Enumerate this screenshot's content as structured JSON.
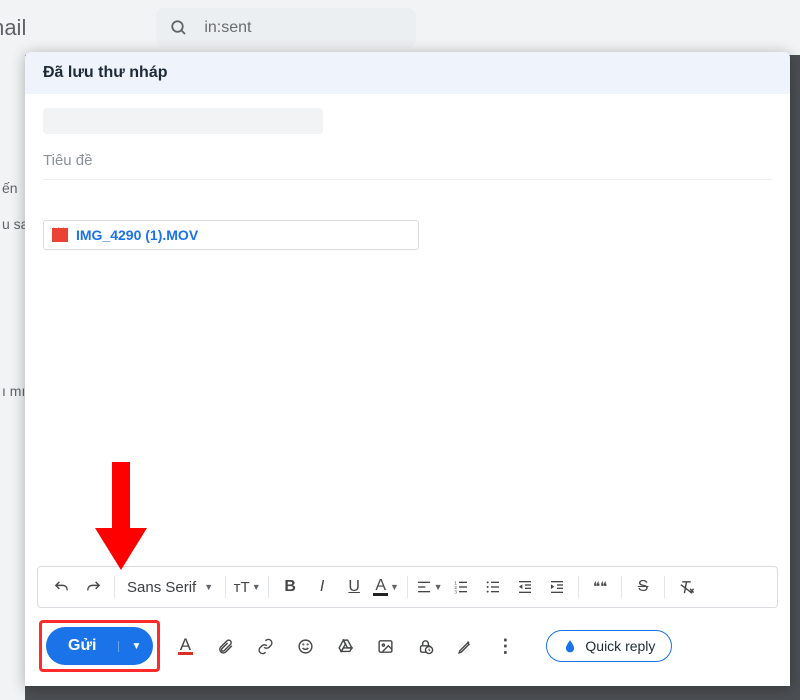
{
  "background": {
    "logo_fragment": "mail",
    "search_value": "in:sent",
    "side_label_1": "ến",
    "side_label_2": "u sa",
    "side_label_3": "ı mı"
  },
  "compose": {
    "header": "Đã lưu thư nháp",
    "subject_placeholder": "Tiêu đề",
    "attachment_name": "IMG_4290 (1).MOV"
  },
  "format_toolbar": {
    "font_name": "Sans Serif",
    "size_label": "тT",
    "bold": "B",
    "italic": "I",
    "underline": "U",
    "text_color": "A",
    "quote": "❝❝"
  },
  "bottom_toolbar": {
    "send_label": "Gửi",
    "text_color": "A",
    "quick_reply_label": "Quick reply"
  }
}
